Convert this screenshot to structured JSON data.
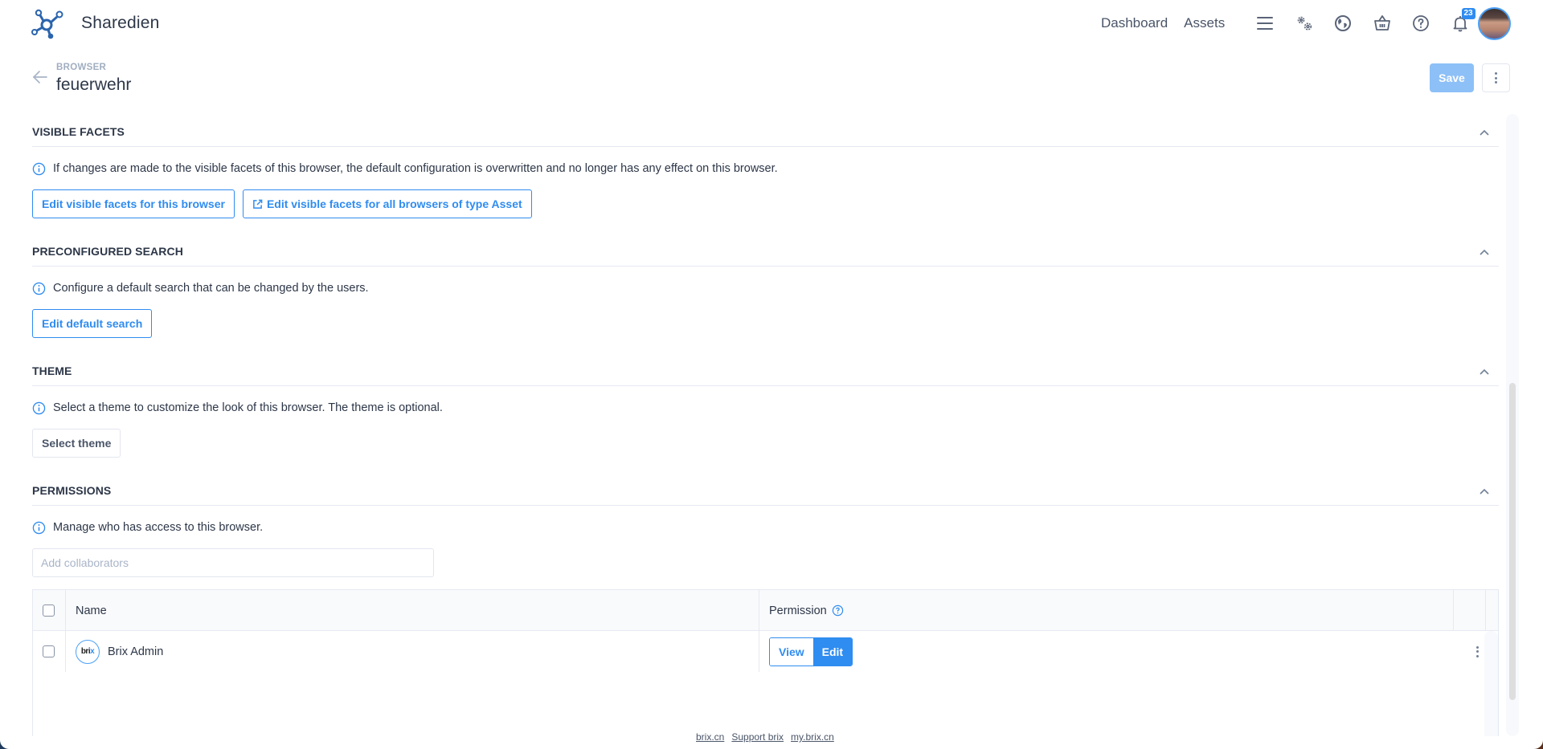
{
  "app": {
    "brand": "Sharedien",
    "accent_color": "#2f8cf0"
  },
  "nav": {
    "links": [
      {
        "label": "Dashboard"
      },
      {
        "label": "Assets"
      }
    ],
    "icons": [
      "menu-icon",
      "settings-gears-icon",
      "globe-icon",
      "basket-icon",
      "help-icon",
      "bell-icon"
    ],
    "notification_count": "23"
  },
  "header": {
    "breadcrumb": "BROWSER",
    "title": "feuerwehr",
    "save_label": "Save"
  },
  "sections": {
    "visible_facets": {
      "title": "VISIBLE FACETS",
      "info": "If changes are made to the visible facets of this browser, the default configuration is overwritten and no longer has any effect on this browser.",
      "button_this": "Edit visible facets for this browser",
      "button_all": "Edit visible facets for all browsers of type Asset"
    },
    "preconfigured_search": {
      "title": "PRECONFIGURED SEARCH",
      "info": "Configure a default search that can be changed by the users.",
      "button": "Edit default search"
    },
    "theme": {
      "title": "THEME",
      "info": "Select a theme to customize the look of this browser. The theme is optional.",
      "button": "Select theme"
    },
    "permissions": {
      "title": "PERMISSIONS",
      "info": "Manage who has access to this browser.",
      "collaborators_placeholder": "Add collaborators",
      "collaborators_value": "",
      "table": {
        "columns": [
          "Name",
          "Permission"
        ],
        "rows": [
          {
            "name": "Brix Admin",
            "avatar_text": "bri",
            "avatar_accent": "x",
            "permission_options": [
              "View",
              "Edit"
            ],
            "selected": "Edit",
            "checked": false
          }
        ]
      }
    }
  },
  "footer": {
    "links": [
      "brix.cn",
      "Support brix",
      "my.brix.cn"
    ]
  }
}
